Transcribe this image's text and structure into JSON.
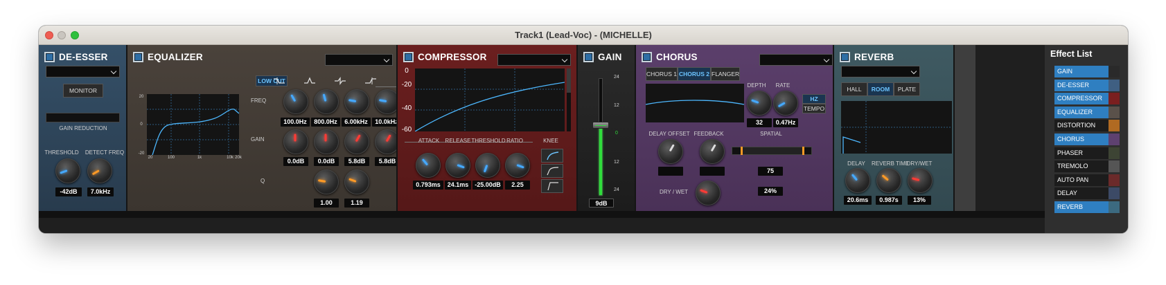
{
  "window": {
    "title": "Track1 (Lead-Voc) - (MICHELLE)"
  },
  "deesser": {
    "title": "DE-ESSER",
    "monitor_label": "MONITOR",
    "gain_reduction_label": "GAIN REDUCTION",
    "threshold_label": "THRESHOLD",
    "detect_freq_label": "DETECT FREQ",
    "threshold_value": "-42dB",
    "detect_freq_value": "7.0kHz"
  },
  "equalizer": {
    "title": "EQUALIZER",
    "low_cut_label": "LOW CUT",
    "freq_label": "FREQ",
    "gain_label": "GAIN",
    "q_label": "Q",
    "graph_y_labels": [
      "20",
      "0",
      "-20"
    ],
    "graph_x_labels": [
      "20",
      "100",
      "1k",
      "10k",
      "20k"
    ],
    "freq_values": [
      "100.0Hz",
      "800.0Hz",
      "6.00kHz",
      "10.0kHz"
    ],
    "gain_values": [
      "0.0dB",
      "0.0dB",
      "5.8dB",
      "5.8dB"
    ],
    "q_values": [
      "1.00",
      "1.19"
    ]
  },
  "compressor": {
    "title": "COMPRESSOR",
    "y_labels": [
      "0",
      "-20",
      "-40",
      "-60"
    ],
    "attack_label": "ATTACK",
    "release_label": "RELEASE",
    "threshold_label": "THRESHOLD",
    "ratio_label": "RATIO",
    "knee_label": "KNEE",
    "attack_value": "0.793ms",
    "release_value": "24.1ms",
    "threshold_value": "-25.00dB",
    "ratio_value": "2.25"
  },
  "gain": {
    "title": "GAIN",
    "scale": [
      "24",
      "12",
      "0",
      "12",
      "24"
    ],
    "value": "9dB",
    "level_percent": 60
  },
  "chorus": {
    "title": "CHORUS",
    "tabs": [
      "CHORUS 1",
      "CHORUS 2",
      "FLANGER"
    ],
    "active_tab": "CHORUS 2",
    "depth_label": "DEPTH",
    "rate_label": "RATE",
    "depth_value": "32",
    "rate_value": "0.47Hz",
    "hz_label": "HZ",
    "tempo_label": "TEMPO",
    "delay_offset_label": "DELAY OFFSET",
    "feedback_label": "FEEDBACK",
    "spatial_label": "SPATIAL",
    "spatial_value": "75",
    "dry_wet_label": "DRY / WET",
    "dry_wet_value": "24%"
  },
  "reverb": {
    "title": "REVERB",
    "types": [
      "HALL",
      "ROOM",
      "PLATE"
    ],
    "active_type": "ROOM",
    "delay_label": "DELAY",
    "reverb_time_label": "REVERB TIME",
    "dry_wet_label": "DRY/WET",
    "delay_value": "20.6ms",
    "reverb_time_value": "0.987s",
    "dry_wet_value": "13%"
  },
  "effect_list": {
    "title": "Effect List",
    "items": [
      {
        "name": "GAIN",
        "active": true,
        "color": "#2a2a2a"
      },
      {
        "name": "DE-ESSER",
        "active": true,
        "color": "#3f5f82"
      },
      {
        "name": "COMPRESSOR",
        "active": true,
        "color": "#7a1f1f"
      },
      {
        "name": "EQUALIZER",
        "active": true,
        "color": "#5a514a"
      },
      {
        "name": "DISTORTION",
        "active": false,
        "color": "#b06a22"
      },
      {
        "name": "CHORUS",
        "active": true,
        "color": "#5e4170"
      },
      {
        "name": "PHASER",
        "active": false,
        "color": "#3d4434"
      },
      {
        "name": "TREMOLO",
        "active": false,
        "color": "#555555"
      },
      {
        "name": "AUTO PAN",
        "active": false,
        "color": "#6b2a2a"
      },
      {
        "name": "DELAY",
        "active": false,
        "color": "#3c4a66"
      },
      {
        "name": "REVERB",
        "active": true,
        "color": "#3c6a80"
      }
    ]
  },
  "colors": {
    "accent_blue": "#2f7fc1",
    "knob_blue": "#45a9ff",
    "knob_red": "#ff3b35",
    "knob_orange": "#ff9a26",
    "meter_green": "#2fdc3b"
  }
}
